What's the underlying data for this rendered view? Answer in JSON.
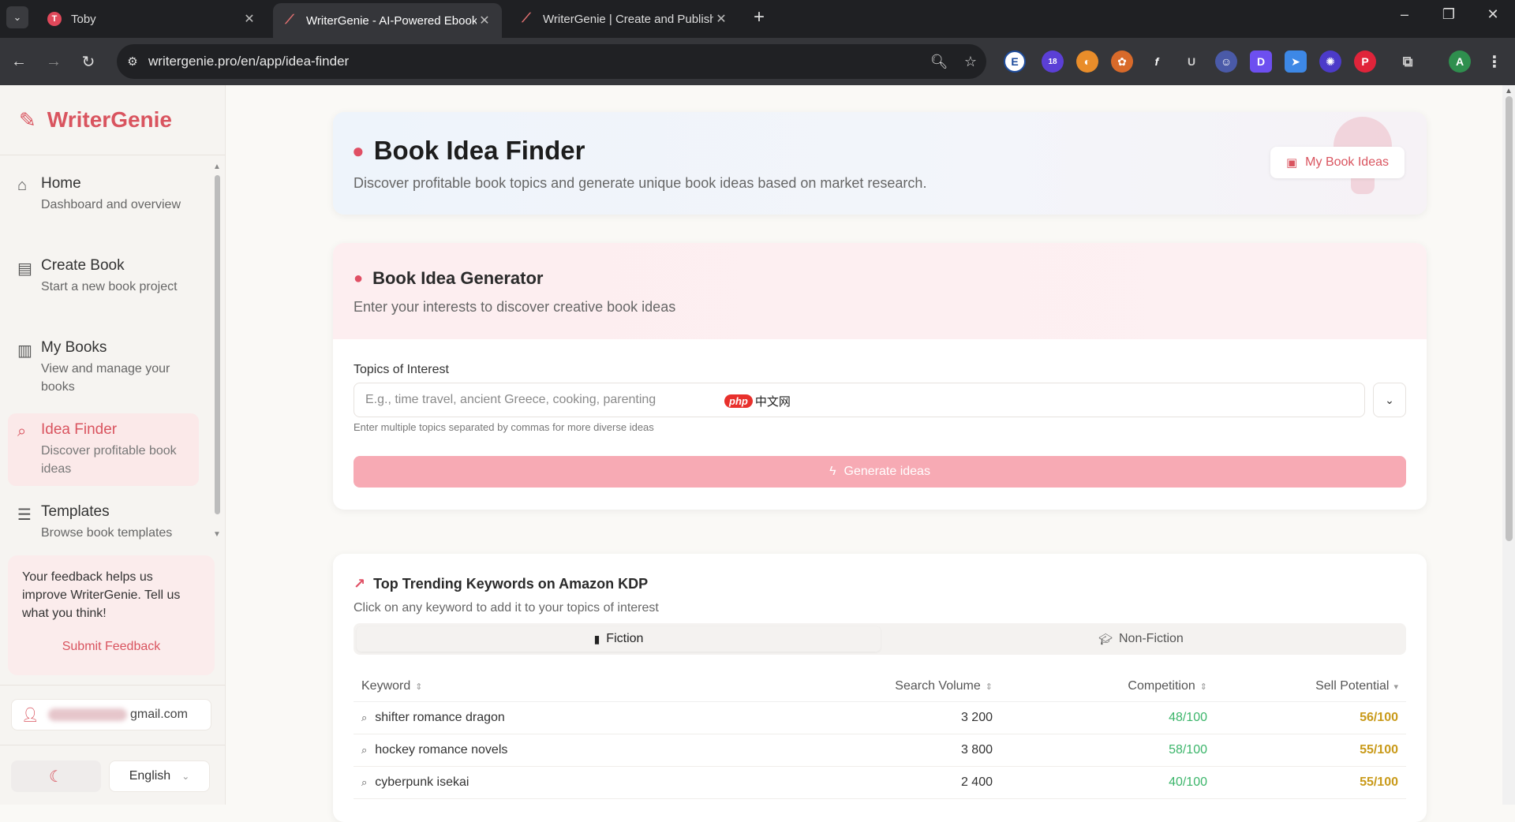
{
  "browser": {
    "tabs": [
      {
        "title": "Toby",
        "icon": "toby-favicon",
        "active": false
      },
      {
        "title": "WriterGenie - AI-Powered Ebook",
        "icon": "feather-favicon",
        "active": true
      },
      {
        "title": "WriterGenie | Create and Publish",
        "icon": "feather-favicon",
        "active": false
      }
    ],
    "url": "writergenie.pro/en/app/idea-finder",
    "extension_badge": "18",
    "profile_initial": "A"
  },
  "sidebar": {
    "brand": "WriterGenie",
    "items": [
      {
        "title": "Home",
        "desc": "Dashboard and overview",
        "icon": "home-icon"
      },
      {
        "title": "Create Book",
        "desc": "Start a new book project",
        "icon": "book-icon"
      },
      {
        "title": "My Books",
        "desc": "View and manage your books",
        "icon": "books-open-icon"
      },
      {
        "title": "Idea Finder",
        "desc": "Discover profitable book ideas",
        "icon": "search-icon"
      },
      {
        "title": "Templates",
        "desc": "Browse book templates",
        "icon": "layers-icon"
      }
    ],
    "feedback": {
      "text": "Your feedback helps us improve WriterGenie. Tell us what you think!",
      "button": "Submit Feedback"
    },
    "user_email_suffix": "gmail.com",
    "language": "English"
  },
  "hero": {
    "title": "Book Idea Finder",
    "subtitle": "Discover profitable book topics and generate unique book ideas based on market research.",
    "my_ideas_button": "My Book Ideas"
  },
  "generator": {
    "title": "Book Idea Generator",
    "subtitle": "Enter your interests to discover creative book ideas",
    "field_label": "Topics of Interest",
    "placeholder": "E.g., time travel, ancient Greece, cooking, parenting",
    "hint": "Enter multiple topics separated by commas for more diverse ideas",
    "button": "Generate ideas"
  },
  "watermark": {
    "badge": "php",
    "text": "中文网"
  },
  "trending": {
    "title": "Top Trending Keywords on Amazon KDP",
    "subtitle": "Click on any keyword to add it to your topics of interest",
    "tabs": [
      "Fiction",
      "Non-Fiction"
    ],
    "columns": [
      "Keyword",
      "Search Volume",
      "Competition",
      "Sell Potential"
    ],
    "rows": [
      {
        "keyword": "shifter romance dragon",
        "volume": "3 200",
        "competition": "48/100",
        "sell": "56/100"
      },
      {
        "keyword": "hockey romance novels",
        "volume": "3 800",
        "competition": "58/100",
        "sell": "55/100"
      },
      {
        "keyword": "cyberpunk isekai",
        "volume": "2 400",
        "competition": "40/100",
        "sell": "55/100"
      }
    ]
  },
  "colors": {
    "brand": "#d9545f",
    "competition": "#3bb56a",
    "sell_potential": "#c99a1a",
    "generate_button": "#f7aab4"
  }
}
